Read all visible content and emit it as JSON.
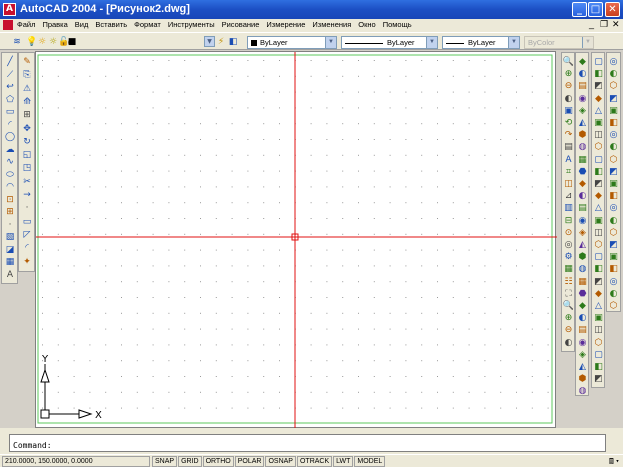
{
  "titlebar": {
    "title": "AutoCAD 2004 - [Рисунок2.dwg]",
    "minimize_label": "_",
    "maximize_label": "□",
    "close_label": "✕"
  },
  "menubar": {
    "items": [
      "Файл",
      "Правка",
      "Вид",
      "Вставить",
      "Формат",
      "Инструменты",
      "Рисование",
      "Измерение",
      "Изменения",
      "Окно",
      "Помощь"
    ],
    "doc_minimize": "_",
    "doc_restore": "❐",
    "doc_close": "✕"
  },
  "properties_toolbar": {
    "layer_value": "0",
    "color_value": "ByLayer",
    "linetype_value": "ByLayer",
    "lineweight_value": "ByLayer",
    "plotstyle_value": "ByColor"
  },
  "drawing": {
    "ucs_y_label": "Y",
    "ucs_x_label": "X",
    "background": "#ffffff",
    "grid_color": "#9a9a9a",
    "limits_color": "#5cc85c",
    "crosshair_color": "#e01010"
  },
  "command": {
    "prompt": "Command:"
  },
  "statusbar": {
    "coordinates": "210.0000, 150.0000, 0.0000",
    "toggles": [
      "SNAP",
      "GRID",
      "ORTHO",
      "POLAR",
      "OSNAP",
      "OTRACK",
      "LWT",
      "MODEL"
    ]
  },
  "icons": {
    "left_draw": [
      "line-icon",
      "construction-line-icon",
      "polyline-icon",
      "polygon-icon",
      "rectangle-icon",
      "arc-icon",
      "circle-icon",
      "revision-cloud-icon",
      "spline-icon",
      "ellipse-icon",
      "ellipse-arc-icon",
      "insert-block-icon",
      "make-block-icon",
      "point-icon",
      "hatch-icon",
      "region-icon",
      "table-icon",
      "multiline-text-icon"
    ],
    "left_modify": [
      "erase-icon",
      "copy-icon",
      "mirror-icon",
      "offset-icon",
      "array-icon",
      "move-icon",
      "rotate-icon",
      "scale-icon",
      "stretch-icon",
      "trim-icon",
      "extend-icon",
      "break-at-point-icon",
      "break-icon",
      "chamfer-icon",
      "fillet-icon",
      "explode-icon"
    ]
  }
}
